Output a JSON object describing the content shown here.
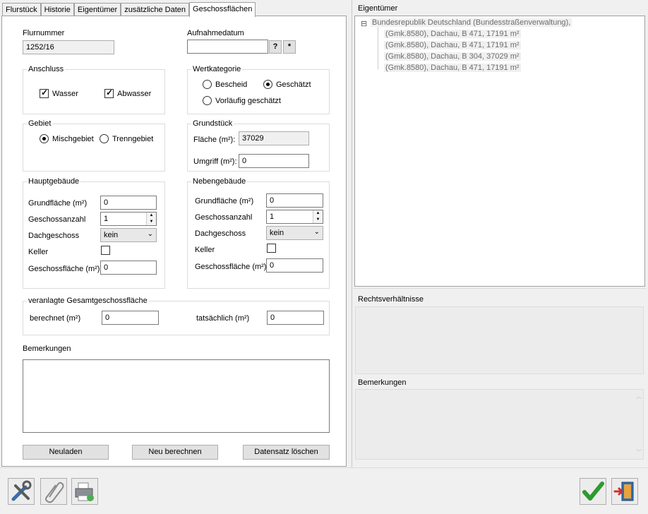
{
  "tabs": [
    "Flurstück",
    "Historie",
    "Eigentümer",
    "zusätzliche Daten",
    "Geschossflächen"
  ],
  "form": {
    "flurnummer_label": "Flurnummer",
    "flurnummer_value": "1252/16",
    "aufnahmedatum_label": "Aufnahmedatum",
    "aufnahmedatum_value": "",
    "help_button": "?",
    "star_button": "*",
    "anschluss": {
      "title": "Anschluss",
      "wasser": "Wasser",
      "abwasser": "Abwasser",
      "wasser_checked": true,
      "abwasser_checked": true
    },
    "wertkategorie": {
      "title": "Wertkategorie",
      "bescheid": "Bescheid",
      "geschaetzt": "Geschätzt",
      "vorlaeufig": "Vorläufig geschätzt",
      "selected": "geschaetzt"
    },
    "gebiet": {
      "title": "Gebiet",
      "misch": "Mischgebiet",
      "trenn": "Trenngebiet",
      "selected": "misch"
    },
    "grundstueck": {
      "title": "Grundstück",
      "flaeche_label": "Fläche (m²):",
      "flaeche_value": "37029",
      "umgriff_label": "Umgriff (m²):",
      "umgriff_value": "0"
    },
    "hauptgebaeude": {
      "title": "Hauptgebäude",
      "grundflaeche_label": "Grundfläche (m²)",
      "grundflaeche_value": "0",
      "geschossanzahl_label": "Geschossanzahl",
      "geschossanzahl_value": "1",
      "dachgeschoss_label": "Dachgeschoss",
      "dachgeschoss_value": "kein",
      "keller_label": "Keller",
      "keller_checked": false,
      "geschossflaeche_label": "Geschossfläche (m²)",
      "geschossflaeche_value": "0"
    },
    "nebengebaeude": {
      "title": "Nebengebäude",
      "grundflaeche_label": "Grundfläche (m²)",
      "grundflaeche_value": "0",
      "geschossanzahl_label": "Geschossanzahl",
      "geschossanzahl_value": "1",
      "dachgeschoss_label": "Dachgeschoss",
      "dachgeschoss_value": "kein",
      "keller_label": "Keller",
      "keller_checked": false,
      "geschossflaeche_label": "Geschossfläche (m²)",
      "geschossflaeche_value": "0"
    },
    "gesamt": {
      "title": "veranlagte Gesamtgeschossfläche",
      "berechnet_label": "berechnet (m²)",
      "berechnet_value": "0",
      "tatsaechlich_label": "tatsächlich (m²)",
      "tatsaechlich_value": "0"
    },
    "bemerkungen_label": "Bemerkungen",
    "bemerkungen_value": "",
    "buttons": {
      "neuladen": "Neuladen",
      "neu_berechnen": "Neu berechnen",
      "loeschen": "Datensatz löschen"
    }
  },
  "right": {
    "eigentuemer_label": "Eigentümer",
    "tree": {
      "expander": "⊟",
      "root": "Bundesrepublik Deutschland (Bundesstraßenverwaltung),",
      "children": [
        "(Gmk.8580), Dachau, B 471, 17191 m²",
        "(Gmk.8580), Dachau, B 471, 17191 m²",
        "(Gmk.8580), Dachau, B 304, 37029 m²",
        "(Gmk.8580), Dachau, B 471, 17191 m²"
      ]
    },
    "rechtsverhaeltnisse_label": "Rechtsverhältnisse",
    "bemerkungen_label": "Bemerkungen"
  },
  "toolbar_icons": [
    "tools-icon",
    "paperclip-icon",
    "printer-icon"
  ],
  "action_icons": [
    "ok-check-icon",
    "exit-door-icon"
  ]
}
